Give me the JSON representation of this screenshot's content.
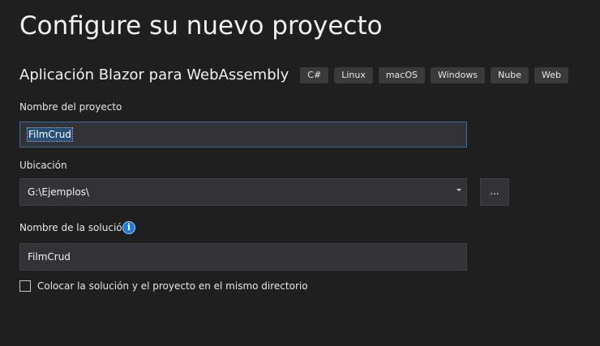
{
  "header": {
    "title": "Configure su nuevo proyecto"
  },
  "template": {
    "name": "Aplicación Blazor para WebAssembly",
    "tags": [
      "C#",
      "Linux",
      "macOS",
      "Windows",
      "Nube",
      "Web"
    ]
  },
  "project_name": {
    "label": "Nombre del proyecto",
    "value": "FilmCrud"
  },
  "location": {
    "label": "Ubicación",
    "value": "G:\\Ejemplos\\",
    "browse_label": "..."
  },
  "solution_name": {
    "label": "Nombre de la solución",
    "value": "FilmCrud",
    "info_icon": "info-icon"
  },
  "same_directory": {
    "label": "Colocar la solución y el proyecto en el mismo directorio",
    "checked": false
  },
  "colors": {
    "background": "#1f1f1f",
    "selection": "#264f78",
    "info": "#1f7bd6"
  }
}
